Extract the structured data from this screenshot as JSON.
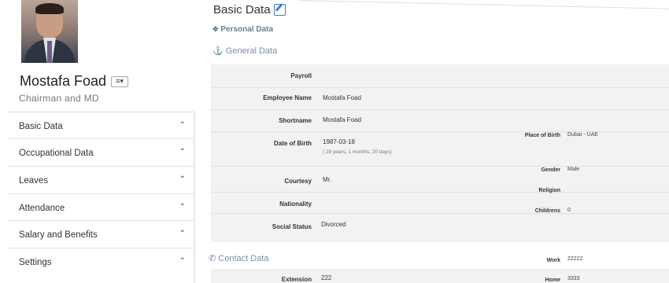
{
  "profile": {
    "name": "Mostafa Foad",
    "dropdown_icon": "≡▾",
    "title": "Chairman and MD"
  },
  "menu": {
    "items": [
      {
        "label": "Basic Data"
      },
      {
        "label": "Occupational Data"
      },
      {
        "label": "Leaves"
      },
      {
        "label": "Attendance"
      },
      {
        "label": "Salary and Benefits"
      },
      {
        "label": "Settings"
      }
    ],
    "chevron": "⌄"
  },
  "main": {
    "title": "Basic Data",
    "personal_data": "Personal Data",
    "general_data": "General Data",
    "contact_data": "Contact Data"
  },
  "fields": {
    "payroll": "Payroll",
    "employee_name_label": "Employee Name",
    "employee_name": "Mostafa Foad",
    "shortname_label": "Shortname",
    "shortname": "Mostafa Foad",
    "dob_label": "Date of Birth",
    "dob": "1987-03-18",
    "age": "( 28 years, 1 months, 20 days)",
    "place_of_birth_label": "Place of Birth",
    "place_of_birth": "Dubai - UAE",
    "gender_label": "Gender",
    "gender": "Male",
    "courtesy_label": "Courtesy",
    "courtesy": "Mr.",
    "religion_label": "Religion",
    "nationality_label": "Nationality",
    "childrens_label": "Childrens",
    "childrens": "0",
    "social_status_label": "Social Status",
    "social_status": "Divorced"
  },
  "contact": {
    "work_label": "Work",
    "work": "22222",
    "extension_label": "Extension",
    "extension": "222",
    "home_label": "Home",
    "home": "3333"
  }
}
